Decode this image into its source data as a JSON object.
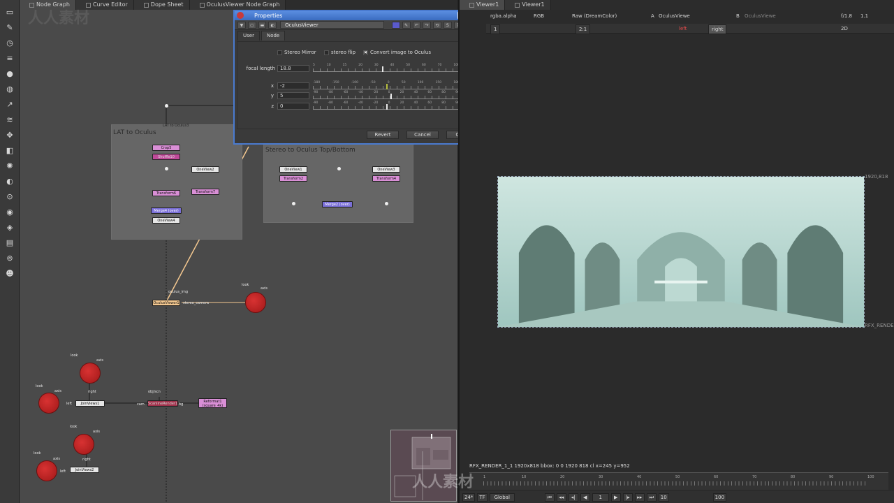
{
  "graph_tabs": [
    {
      "label": "Node Graph",
      "active": true
    },
    {
      "label": "Curve Editor",
      "active": false
    },
    {
      "label": "Dope Sheet",
      "active": false
    },
    {
      "label": "OculusViewer Node Graph",
      "active": false
    }
  ],
  "toolbar_icons": [
    "image-icon",
    "draw-icon",
    "time-icon",
    "channel-icon",
    "color-icon",
    "filter-icon",
    "keyer-icon",
    "merge-icon",
    "transform-icon",
    "3d-icon",
    "particles-icon",
    "deep-icon",
    "views-icon",
    "metadata-icon",
    "toolsets-icon",
    "other-icon",
    "furnace-icon",
    "oculus-icon"
  ],
  "backdrops": {
    "lat": {
      "title": "LAT to Oculus"
    },
    "stereo": {
      "title": "Stereo to Oculus Top/Bottom"
    }
  },
  "nodes": {
    "lat_to_oculus": "LAT to Oculus3",
    "crop": "Crop5",
    "shuffle": "Shuffle10",
    "oneview_a": "OneView2",
    "transform6": "Transform6",
    "transform7": "Transform7",
    "merge_over": "Merge4 (over)",
    "oneview4": "OneView4",
    "oneview1": "OneView1",
    "oneview3": "OneView3",
    "transform2": "Transform2",
    "transform4": "Transform4",
    "merge2_over": "Merge2 (over)",
    "oculusviewer": "OculusViewer1",
    "joinviews1": "JoinViews1",
    "joinviews2": "JoinViews2",
    "reformat": "Reformat1",
    "reformat_sub": "(square_4k)",
    "scanline": "ScanlineRender1"
  },
  "graph_labels": {
    "oculus_img": "oculus_img",
    "stereo_camera": "stereo_camera",
    "look": "look",
    "axis": "axis",
    "right": "right",
    "left": "left",
    "obj_scn": "obj/scn",
    "cam": "cam",
    "bg": "bg"
  },
  "properties": {
    "title": "Properties",
    "node_name": "OculusViewer",
    "tabs": [
      {
        "label": "User",
        "active": true
      },
      {
        "label": "Node",
        "active": false
      }
    ],
    "stereo_mirror": {
      "label": "Stereo Mirror",
      "checked": false
    },
    "stereo_flip": {
      "label": "stereo flip",
      "checked": false
    },
    "convert_image": {
      "label": "Convert image to Oculus",
      "checked": true
    },
    "focal_length": {
      "label": "focal length",
      "value": "18.8",
      "ticks": [
        "5",
        "10",
        "15",
        "20",
        "30",
        "40",
        "50",
        "60",
        "70",
        "100"
      ],
      "handle": 0.47
    },
    "x": {
      "label": "x",
      "value": "-2",
      "ticks": [
        "-180",
        "-150",
        "-100",
        "-50",
        "0",
        "50",
        "100",
        "150",
        "180"
      ],
      "handle": 0.5
    },
    "y": {
      "label": "y",
      "value": "5",
      "ticks": [
        "-90",
        "-80",
        "-60",
        "-40",
        "-20",
        "0",
        "20",
        "40",
        "60",
        "80",
        "90"
      ],
      "handle": 0.53
    },
    "z": {
      "label": "z",
      "value": "0",
      "ticks": [
        "-90",
        "-80",
        "-60",
        "-40",
        "-20",
        "0",
        "20",
        "40",
        "60",
        "80",
        "90"
      ],
      "handle": 0.5
    },
    "revert": "Revert",
    "cancel": "Cancel",
    "close": "Close"
  },
  "viewer": {
    "tabs": [
      {
        "label": "Viewer1",
        "active": true
      },
      {
        "label": "Viewer1",
        "active": false
      }
    ],
    "channels": "rgba.alpha",
    "colorspace": "RGB",
    "lut": "Raw (DreamColor)",
    "input_a_label": "A",
    "input_a": "OculusViewe",
    "input_b_label": "B",
    "input_b": "OculusViewe",
    "gain": "f/1.8",
    "gamma": "1.1",
    "frame_field": "1",
    "zoom": "2:1",
    "view_left": "left",
    "view_right": "right",
    "mode": "2D",
    "format_size": "1920,818",
    "format_name": "RFX_RENDER",
    "info_line": "RFX_RENDER_1_1 1920x818  bbox: 0 0 1920 818 cl  x=245 y=952",
    "timeline_ticks": [
      "1",
      "10",
      "20",
      "30",
      "40",
      "50",
      "60",
      "70",
      "80",
      "90",
      "100"
    ],
    "fps": "24*",
    "tf": "TF",
    "global": "Global",
    "current_frame": "1",
    "step": "10",
    "end_frame": "100"
  },
  "watermark": "人人素材"
}
